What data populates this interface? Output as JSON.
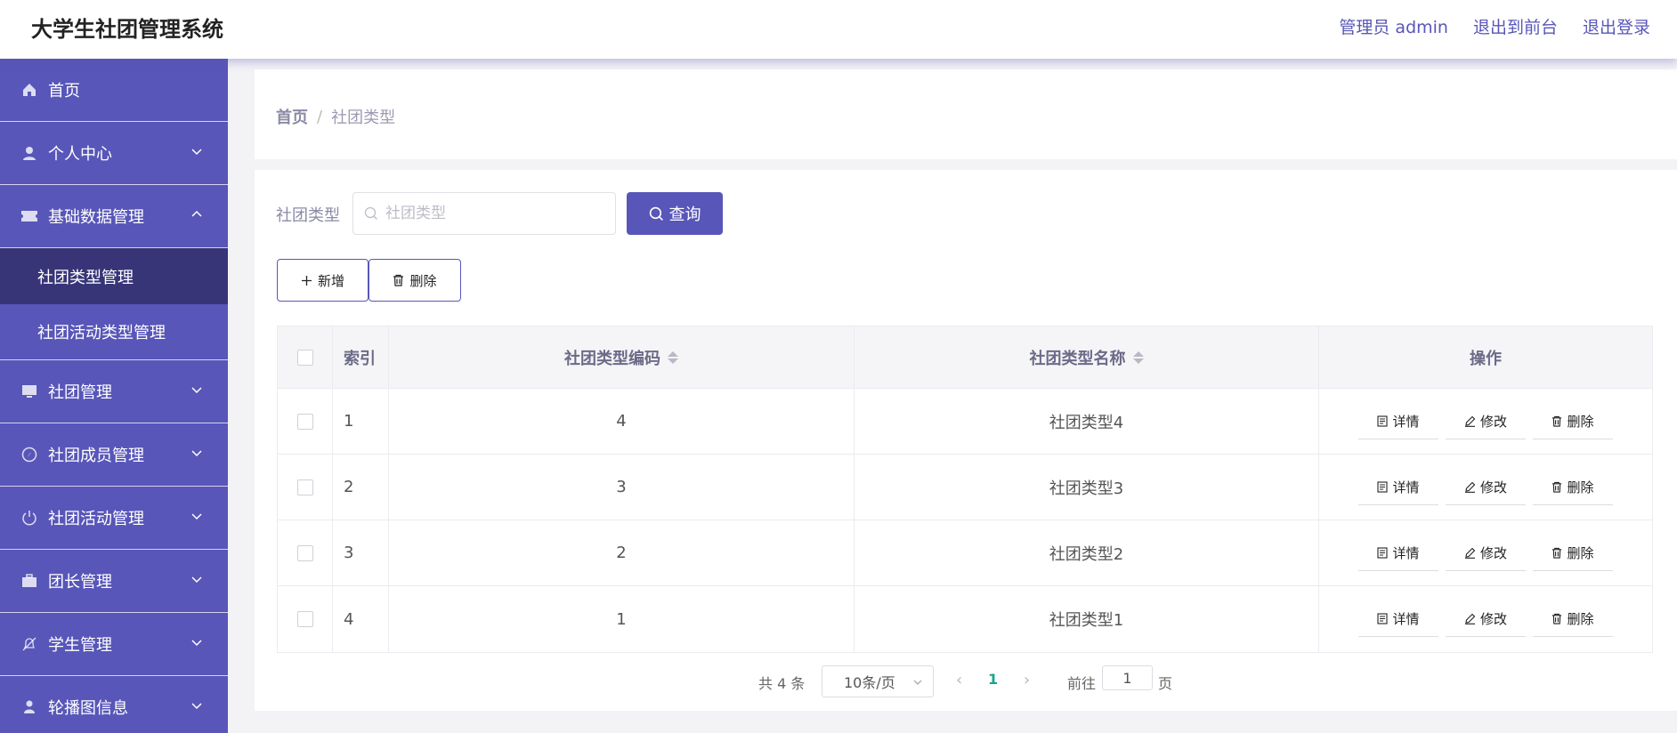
{
  "app": {
    "title": "大学生社团管理系统"
  },
  "header": {
    "links": [
      "管理员 admin",
      "退出到前台",
      "退出登录"
    ]
  },
  "sidebar": {
    "items": [
      {
        "label": "首页",
        "icon": "home-icon"
      },
      {
        "label": "个人中心",
        "icon": "user-icon"
      },
      {
        "label": "基础数据管理",
        "icon": "ticket-icon",
        "expanded": true,
        "children": [
          {
            "label": "社团类型管理",
            "active": true
          },
          {
            "label": "社团活动类型管理"
          }
        ]
      },
      {
        "label": "社团管理",
        "icon": "monitor-icon"
      },
      {
        "label": "社团成员管理",
        "icon": "compass-icon"
      },
      {
        "label": "社团活动管理",
        "icon": "power-icon"
      },
      {
        "label": "团长管理",
        "icon": "briefcase-icon"
      },
      {
        "label": "学生管理",
        "icon": "bell-off-icon"
      },
      {
        "label": "轮播图信息",
        "icon": "person-icon"
      }
    ]
  },
  "breadcrumb": {
    "home": "首页",
    "separator": "/",
    "current": "社团类型"
  },
  "search": {
    "label": "社团类型",
    "placeholder": "社团类型",
    "button": "查询"
  },
  "actions": {
    "add": "新增",
    "delete": "删除"
  },
  "table": {
    "headers": {
      "index": "索引",
      "code": "社团类型编码",
      "name": "社团类型名称",
      "ops": "操作"
    },
    "rows": [
      {
        "index": "1",
        "code": "4",
        "name": "社团类型4"
      },
      {
        "index": "2",
        "code": "3",
        "name": "社团类型3"
      },
      {
        "index": "3",
        "code": "2",
        "name": "社团类型2"
      },
      {
        "index": "4",
        "code": "1",
        "name": "社团类型1"
      }
    ],
    "row_actions": {
      "detail": "详情",
      "edit": "修改",
      "delete": "删除"
    }
  },
  "pagination": {
    "total": "共 4 条",
    "page_size": "10条/页",
    "current_page": "1",
    "goto_label": "前往",
    "goto_value": "1",
    "page_suffix": "页"
  },
  "colors": {
    "primary": "#5856b8",
    "active_menu": "#373577",
    "page_active": "#1aa68a"
  }
}
